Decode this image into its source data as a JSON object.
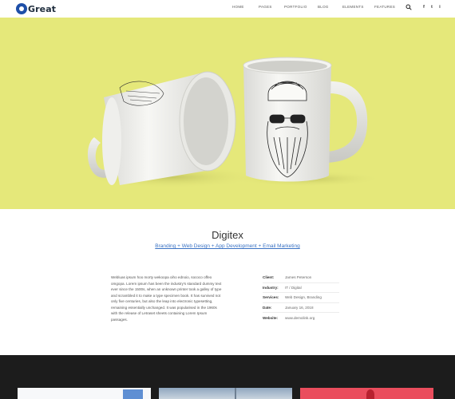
{
  "header": {
    "logo_text": "Great",
    "nav": [
      "HOME",
      "PAGES",
      "PORTFOLIO",
      "BLOG",
      "ELEMENTS",
      "FEATURES"
    ],
    "social": [
      "f",
      "t",
      "i"
    ]
  },
  "colors": {
    "hero_bg": "#e5e87a",
    "accent": "#3b73c4",
    "dark_band": "#1c1c1c"
  },
  "project": {
    "title": "Digitex",
    "categories": "Branding + Web Design + App Development + Email Marketing",
    "description": "Webluas ipsum hoo morty wekoopa oiho ednoio, sococo offeo omgopa. Lorem ipsum has been the industry's standard dummy text ever since the 1500s, when an unknown printer took a galley of type and scrambled it to make a type specimen book. It has survived not only five centuries, but also the leap into electronic typesetting, remaining essentially unchanged. It was popularised in the 1960s with the release of Letraset sheets containing Lorem Ipsum passages.",
    "details": [
      {
        "key": "Client:",
        "value": "James Peterson"
      },
      {
        "key": "Industry:",
        "value": "IT / Digital"
      },
      {
        "key": "Services:",
        "value": "Web Design, Branding"
      },
      {
        "key": "Date:",
        "value": "January 16, 2018"
      },
      {
        "key": "Website:",
        "value": "www.demolink.org"
      }
    ]
  }
}
